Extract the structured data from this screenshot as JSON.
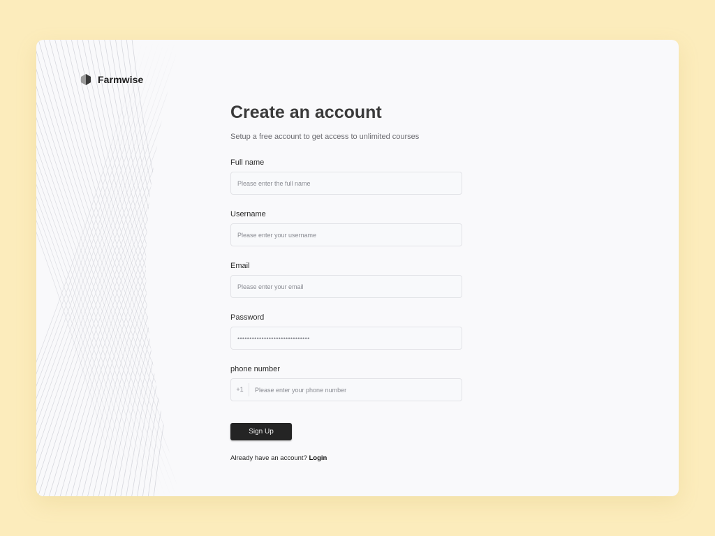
{
  "brand": {
    "name": "Farmwise",
    "logo_icon": "hexagon-logo-icon"
  },
  "heading": {
    "title": "Create an account",
    "subtitle": "Setup a free account to get access to unlimited courses"
  },
  "fields": {
    "full_name": {
      "label": "Full name",
      "placeholder": "Please enter the full name",
      "value": ""
    },
    "username": {
      "label": "Username",
      "placeholder": "Please enter your username",
      "value": ""
    },
    "email": {
      "label": "Email",
      "placeholder": "Please enter your email",
      "value": ""
    },
    "password": {
      "label": "Password",
      "value": "••••••••••••••••••••••••••••••"
    },
    "phone": {
      "label": "phone number",
      "prefix": "+1",
      "placeholder": "Please enter your phone number",
      "value": ""
    }
  },
  "actions": {
    "signup_label": "Sign Up"
  },
  "footer": {
    "prompt": "Already have an account?",
    "login_label": "Login"
  },
  "colors": {
    "page_background": "#fcecbc",
    "card_background": "#f9f9fb",
    "button_background": "#242424",
    "heading_text": "#3a3a3a"
  }
}
